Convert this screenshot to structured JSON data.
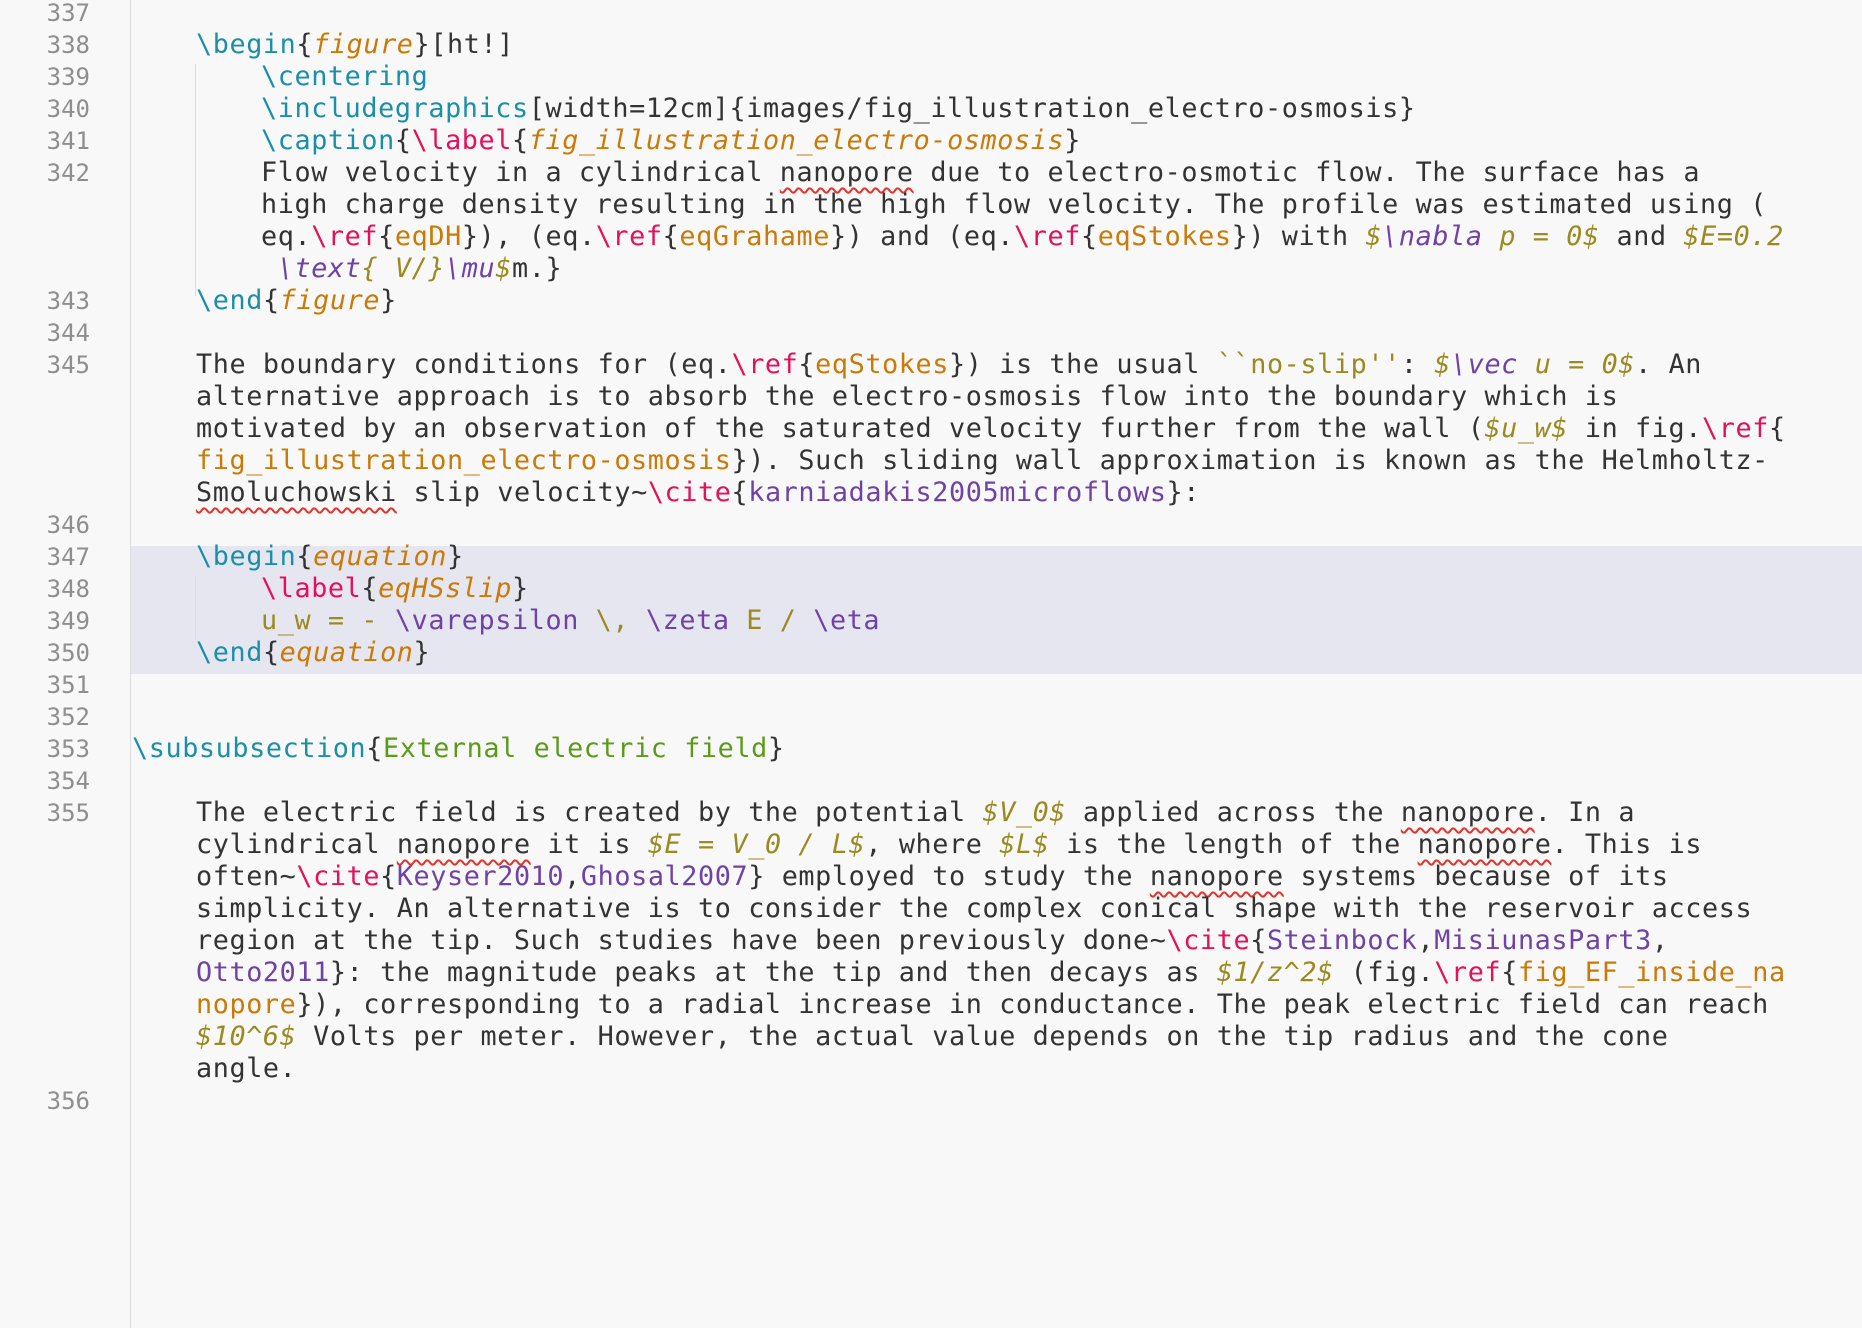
{
  "gutter": [
    "337",
    "338",
    "339",
    "340",
    "341",
    "342",
    "343",
    "344",
    "345",
    "346",
    "347",
    "348",
    "349",
    "350",
    "351",
    "352",
    "353",
    "354",
    "355",
    "356"
  ],
  "l338": {
    "a": "\\begin",
    "b": "{",
    "c": "figure",
    "d": "}[ht!]"
  },
  "l339": {
    "a": "\\centering"
  },
  "l340": {
    "a": "\\includegraphics",
    "b": "[width=12cm]{images/fig_illustration_electro-osmosis}"
  },
  "l341": {
    "a": "\\caption",
    "b": "{",
    "c": "\\label",
    "d": "{",
    "e": "fig_illustration_electro-osmosis",
    "f": "}"
  },
  "l342a": {
    "a": "Flow velocity in a cylindrical ",
    "b": "nanopore",
    "c": " due to electro-osmotic flow. The surface has a"
  },
  "l342b": {
    "a": "high charge density resulting in the high flow velocity. The profile was estimated using ("
  },
  "l342c": {
    "a": "eq.",
    "b": "\\ref",
    "c": "{",
    "d": "eqDH",
    "e": "}), (eq.",
    "f": "\\ref",
    "g": "{",
    "h": "eqGrahame",
    "i": "}) and (eq.",
    "j": "\\ref",
    "k": "{",
    "l": "eqStokes",
    "m": "}) with ",
    "n": "$",
    "o": "\\nabla",
    "p": " p = 0$",
    "q": " and ",
    "r": "$E=0.2"
  },
  "l342d": {
    "a": " \\text",
    "b": "{ V/}",
    "c": "\\mu",
    "d": "$",
    "e": "m.}"
  },
  "l343": {
    "a": "\\end",
    "b": "{",
    "c": "figure",
    "d": "}"
  },
  "l345a": {
    "a": "The boundary conditions for (eq.",
    "b": "\\ref",
    "c": "{",
    "d": "eqStokes",
    "e": "}) is the usual ",
    "f": "``no-slip''",
    "g": ": ",
    "h": "$",
    "i": "\\vec",
    "j": " u = 0$",
    "k": ". An"
  },
  "l345b": {
    "a": "alternative approach is to absorb the electro-osmosis flow into the boundary which is"
  },
  "l345c": {
    "a": "motivated by an observation of the saturated velocity further from the wall (",
    "b": "$u_w$",
    "c": " in fig.",
    "d": "\\ref",
    "e": "{"
  },
  "l345d": {
    "a": "fig_illustration_electro-osmosis",
    "b": "}). Such sliding wall approximation is known as the Helmholtz-"
  },
  "l345e": {
    "a": "Smoluchowski",
    "b": " slip velocity~",
    "c": "\\cite",
    "d": "{",
    "e": "karniadakis2005microflows",
    "f": "}:"
  },
  "l347": {
    "a": "\\begin",
    "b": "{",
    "c": "equation",
    "d": "}"
  },
  "l348": {
    "a": "\\label",
    "b": "{",
    "c": "eqHSslip",
    "d": "}"
  },
  "l349": {
    "a": "u_w = - ",
    "b": "\\varepsilon",
    "c": " \\, ",
    "d": "\\zeta",
    "e": " E / ",
    "f": "\\eta"
  },
  "l350": {
    "a": "\\end",
    "b": "{",
    "c": "equation",
    "d": "}"
  },
  "l353": {
    "a": "\\subsubsection",
    "b": "{",
    "c": "External electric field",
    "d": "}"
  },
  "l355a": {
    "a": "The electric field is created by the potential ",
    "b": "$V_0$",
    "c": " applied across the ",
    "d": "nanopore",
    "e": ". In a"
  },
  "l355b": {
    "a": "cylindrical ",
    "b": "nanopore",
    "c": " it is ",
    "d": "$E = V_0 / L$",
    "e": ", where ",
    "f": "$L$",
    "g": " is the length of the ",
    "h": "nanopore",
    "i": ". This is"
  },
  "l355c": {
    "a": "often~",
    "b": "\\cite",
    "c": "{",
    "d": "Keyser2010",
    "e": ",",
    "f": "Ghosal2007",
    "g": "} employed to study the ",
    "h": "nanopore",
    "i": " systems because of its"
  },
  "l355d": {
    "a": "simplicity. An alternative is to consider the complex conical shape with the reservoir access"
  },
  "l355e": {
    "a": "region at the tip. Such studies have been previously done~",
    "b": "\\cite",
    "c": "{",
    "d": "Steinbock",
    "e": ",",
    "f": "MisiunasPart3",
    "g": ","
  },
  "l355f": {
    "a": "Otto2011",
    "b": "}: the magnitude peaks at the tip and then decays as ",
    "c": "$1/z^2$",
    "d": " (fig.",
    "e": "\\ref",
    "f": "{",
    "g": "fig_EF_inside_na"
  },
  "l355g": {
    "a": "nopore",
    "b": "}), corresponding to a radial increase in conductance. The peak electric field can reach"
  },
  "l355h": {
    "a": "$10^6$",
    "b": " Volts per meter. However, the actual value depends on the tip radius and the cone"
  },
  "l355i": {
    "a": "angle."
  }
}
